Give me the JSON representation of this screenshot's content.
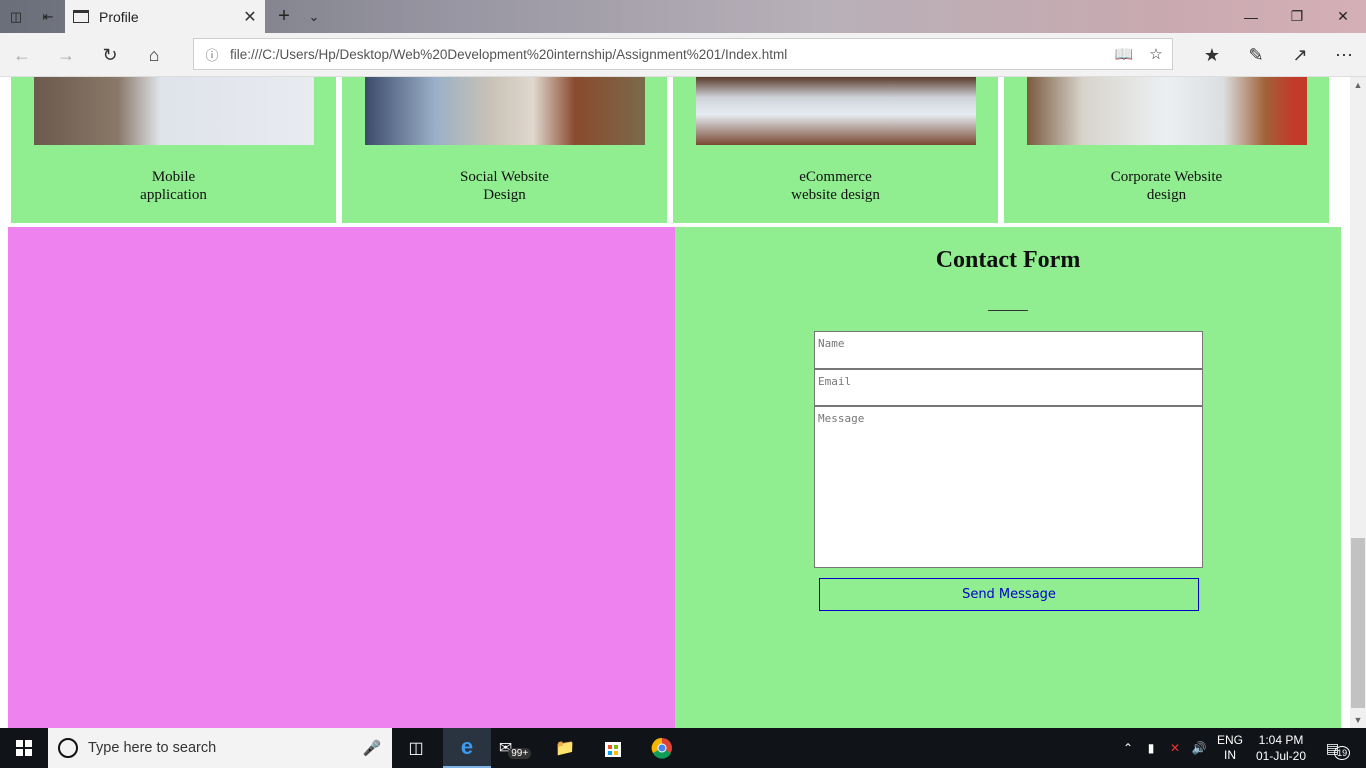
{
  "browser": {
    "tab_title": "Profile",
    "url": "file:///C:/Users/Hp/Desktop/Web%20Development%20internship/Assignment%201/Index.html"
  },
  "services": [
    {
      "line1": "Mobile",
      "line2": "application"
    },
    {
      "line1": "Social Website",
      "line2": "Design"
    },
    {
      "line1": "eCommerce",
      "line2": "website design"
    },
    {
      "line1": "Corporate Website",
      "line2": "design"
    }
  ],
  "contact_form": {
    "title": "Contact Form",
    "name_placeholder": "Name",
    "email_placeholder": "Email",
    "message_placeholder": "Message",
    "send_label": "Send Message"
  },
  "taskbar": {
    "search_placeholder": "Type here to search",
    "mail_badge": "99+",
    "lang_line1": "ENG",
    "lang_line2": "IN",
    "time": "1:04 PM",
    "date": "01-Jul-20",
    "notification_count": "19"
  },
  "colors": {
    "card_bg": "#90ee90",
    "left_panel": "#ee82ee",
    "button_text": "#0000cc"
  }
}
